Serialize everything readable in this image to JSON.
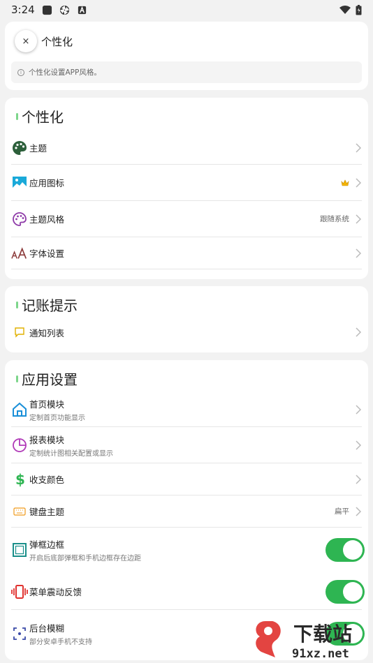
{
  "status_bar": {
    "time": "3:24"
  },
  "header": {
    "title": "个性化",
    "info": "个性化设置APP风格。",
    "close_glyph": "×"
  },
  "sections": {
    "personalization": {
      "title": "个性化",
      "items": [
        {
          "label": "主题"
        },
        {
          "label": "应用图标"
        },
        {
          "label": "主题风格",
          "value": "跟随系统"
        },
        {
          "label": "字体设置"
        }
      ]
    },
    "reminder": {
      "title": "记账提示",
      "items": [
        {
          "label": "通知列表"
        }
      ]
    },
    "app_settings": {
      "title": "应用设置",
      "items": [
        {
          "label": "首页模块",
          "sub": "定制首页功能显示"
        },
        {
          "label": "报表模块",
          "sub": "定制统计图相关配置或显示"
        },
        {
          "label": "收支颜色"
        },
        {
          "label": "键盘主题",
          "value": "扁平"
        },
        {
          "label": "弹框边框",
          "sub": "开启后底部弹框和手机边框存在边距",
          "enabled": true
        },
        {
          "label": "菜单震动反馈",
          "enabled": true
        },
        {
          "label": "后台模糊",
          "sub": "部分安卓手机不支持",
          "enabled": true
        }
      ]
    }
  },
  "watermark": {
    "line1": "下载站",
    "line2": "91xz.net"
  }
}
